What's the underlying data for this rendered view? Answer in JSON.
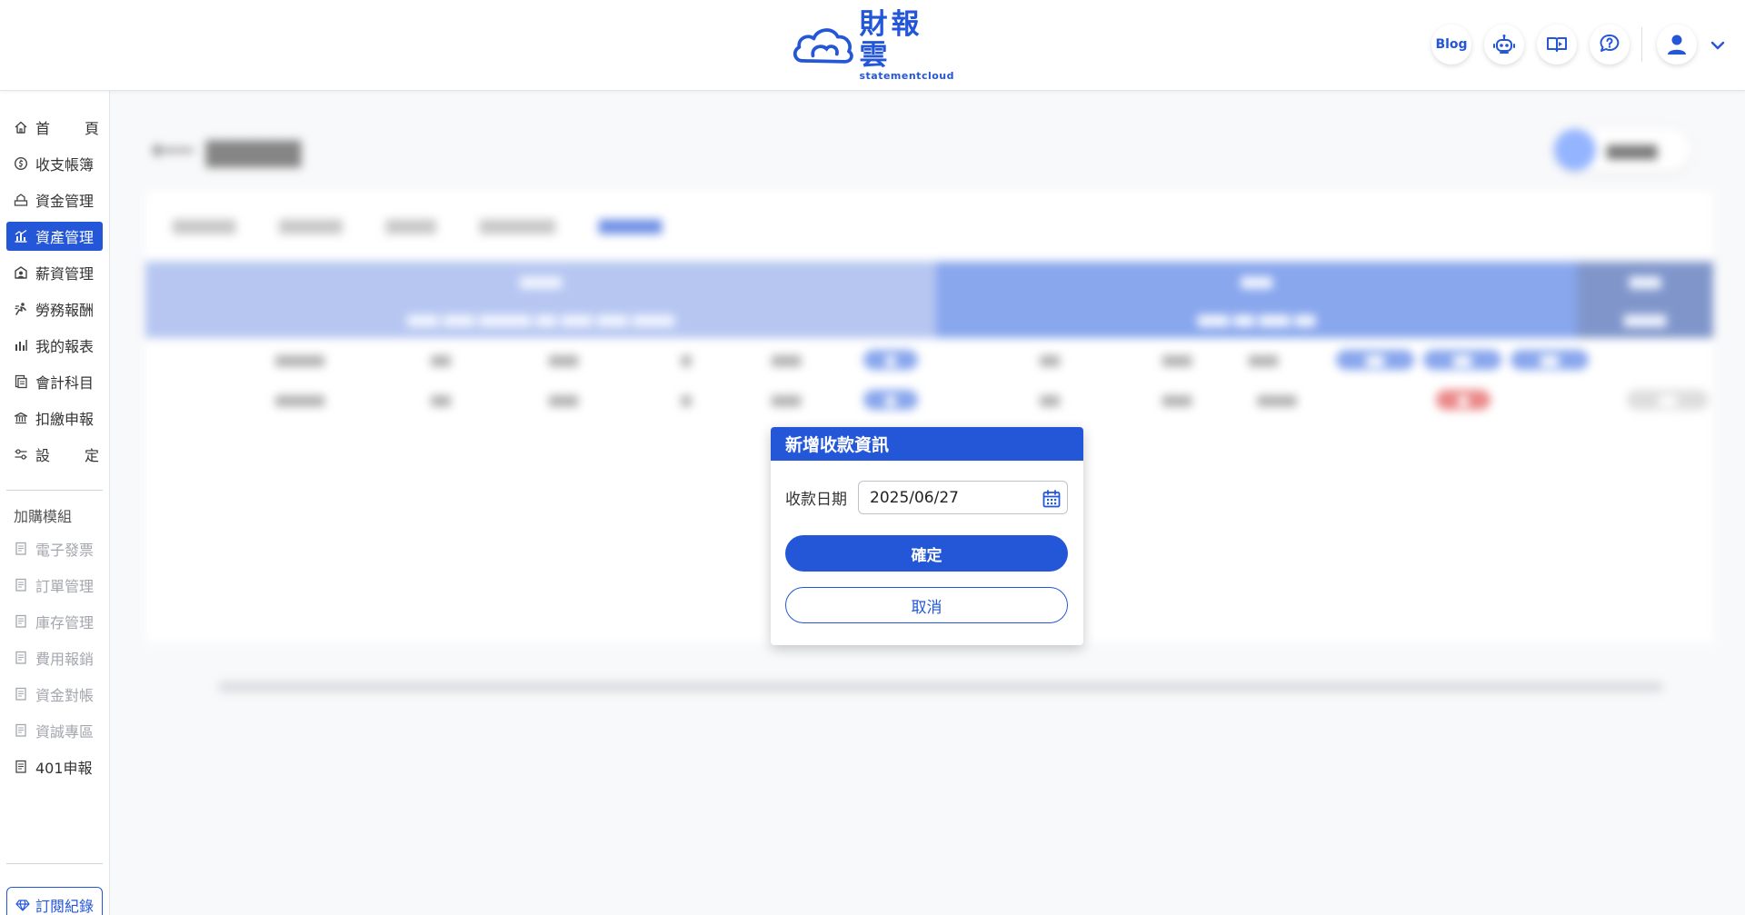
{
  "brand": {
    "name_cn": "財報雲",
    "name_en": "statementcloud",
    "color": "#2456d8"
  },
  "header": {
    "blog_label": "Blog",
    "icons": [
      "robot-icon",
      "video-guide-icon",
      "help-chat-icon",
      "user-avatar-icon"
    ]
  },
  "sidebar": {
    "items": [
      {
        "label": "首頁",
        "icon": "home-icon"
      },
      {
        "label": "收支帳簿",
        "icon": "coin-icon"
      },
      {
        "label": "資金管理",
        "icon": "fund-icon"
      },
      {
        "label": "資產管理",
        "icon": "asset-chart-icon",
        "active": true
      },
      {
        "label": "薪資管理",
        "icon": "payroll-icon"
      },
      {
        "label": "勞務報酬",
        "icon": "labor-icon"
      },
      {
        "label": "我的報表",
        "icon": "report-icon"
      },
      {
        "label": "會計科目",
        "icon": "ledger-icon"
      },
      {
        "label": "扣繳申報",
        "icon": "withholding-icon"
      },
      {
        "label": "設定",
        "icon": "settings-icon"
      }
    ],
    "addon_title": "加購模組",
    "addons": [
      {
        "label": "電子發票",
        "disabled": true
      },
      {
        "label": "訂單管理",
        "disabled": true
      },
      {
        "label": "庫存管理",
        "disabled": true
      },
      {
        "label": "費用報銷",
        "disabled": true
      },
      {
        "label": "資金對帳",
        "disabled": true
      },
      {
        "label": "資誠專區",
        "disabled": true
      },
      {
        "label": "401申報",
        "disabled": false
      }
    ],
    "subscription_label": "訂閱紀錄"
  },
  "dialog": {
    "title": "新增收款資訊",
    "date_label": "收款日期",
    "date_value": "2025/06/27",
    "confirm_label": "確定",
    "cancel_label": "取消"
  }
}
